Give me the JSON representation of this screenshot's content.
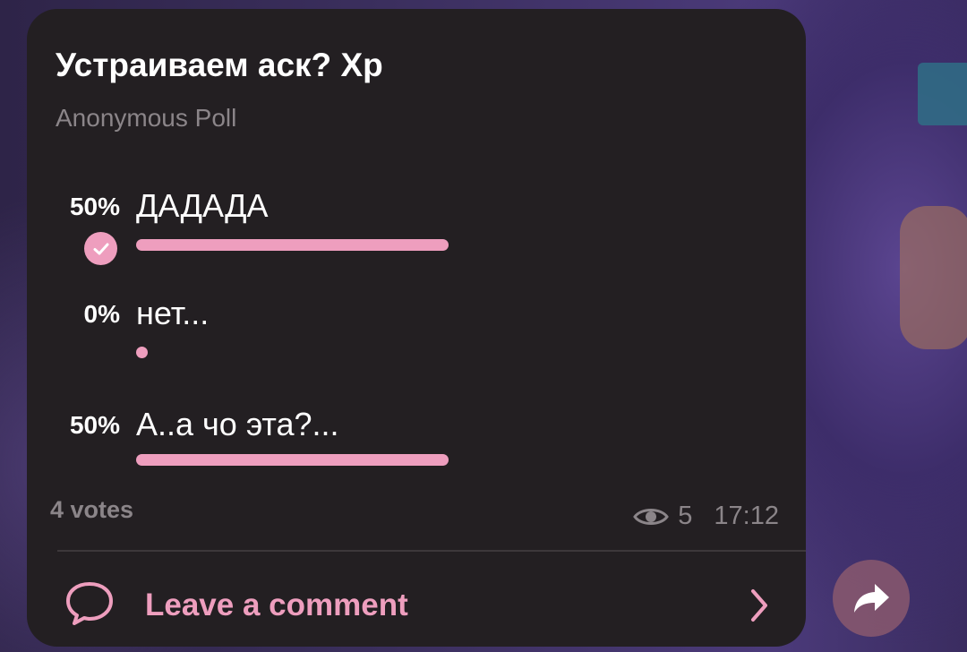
{
  "poll": {
    "title": "Устраиваем аск? Xp",
    "subtitle": "Anonymous Poll",
    "options": [
      {
        "percent": "50%",
        "label": "ДАДАДА",
        "fraction": 0.5,
        "chosen": true
      },
      {
        "percent": "0%",
        "label": "нет...",
        "fraction": 0.0,
        "chosen": false
      },
      {
        "percent": "50%",
        "label": "А..а чо эта?...",
        "fraction": 0.5,
        "chosen": false
      }
    ],
    "votes": "4 votes"
  },
  "meta": {
    "views": "5",
    "time": "17:12",
    "views_icon": "eye-icon"
  },
  "comment": {
    "label": "Leave a comment",
    "icon": "comment-bubble-icon"
  },
  "share": {
    "icon": "share-arrow-icon"
  },
  "colors": {
    "bubble": "#231f22",
    "accent": "#ee9ebe",
    "muted": "#8b8589",
    "text": "#ffffff"
  }
}
